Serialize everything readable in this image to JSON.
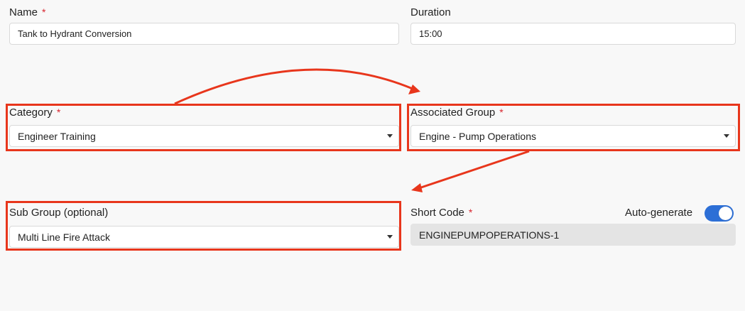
{
  "name": {
    "label": "Name",
    "required_mark": "*",
    "value": "Tank to Hydrant Conversion"
  },
  "duration": {
    "label": "Duration",
    "value": "15:00"
  },
  "category": {
    "label": "Category",
    "required_mark": "*",
    "value": "Engineer Training"
  },
  "associated_group": {
    "label": "Associated Group",
    "required_mark": "*",
    "value": "Engine - Pump Operations"
  },
  "sub_group": {
    "label": "Sub Group (optional)",
    "value": "Multi Line Fire Attack"
  },
  "short_code": {
    "label": "Short Code",
    "required_mark": "*",
    "value": "ENGINEPUMPOPERATIONS-1",
    "auto_generate_label": "Auto-generate",
    "auto_generate_on": true
  },
  "annotation_color": "#e8361c",
  "toggle_color": "#2d6fd6",
  "icons": [
    "caret-down-icon",
    "arrow-annotation",
    "toggle-switch"
  ]
}
